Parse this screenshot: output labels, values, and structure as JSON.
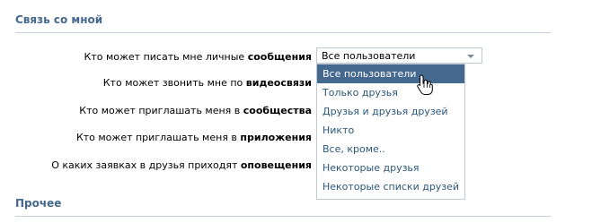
{
  "sections": {
    "contact_title": "Связь со мной",
    "other_title": "Прочее"
  },
  "rows": [
    {
      "prefix": "Кто может писать мне личные ",
      "bold": "сообщения"
    },
    {
      "prefix": "Кто может звонить мне по ",
      "bold": "видеосвязи"
    },
    {
      "prefix": "Кто может приглашать меня в ",
      "bold": "сообщества"
    },
    {
      "prefix": "Кто может приглашать меня в ",
      "bold": "приложения"
    },
    {
      "prefix": "О каких заявках в друзья приходят ",
      "bold": "оповещения"
    }
  ],
  "select": {
    "value": "Все пользователи",
    "options": [
      "Все пользователи",
      "Только друзья",
      "Друзья и друзья друзей",
      "Никто",
      "Все, кроме..",
      "Некоторые друзья",
      "Некоторые списки друзей"
    ],
    "highlighted_index": 0
  },
  "colors": {
    "header": "#45688e",
    "highlight": "#45688e",
    "option_text": "#2b587a",
    "border": "#c0cad5"
  },
  "icons": [
    "dropdown-arrow-icon",
    "hand-cursor-icon"
  ]
}
